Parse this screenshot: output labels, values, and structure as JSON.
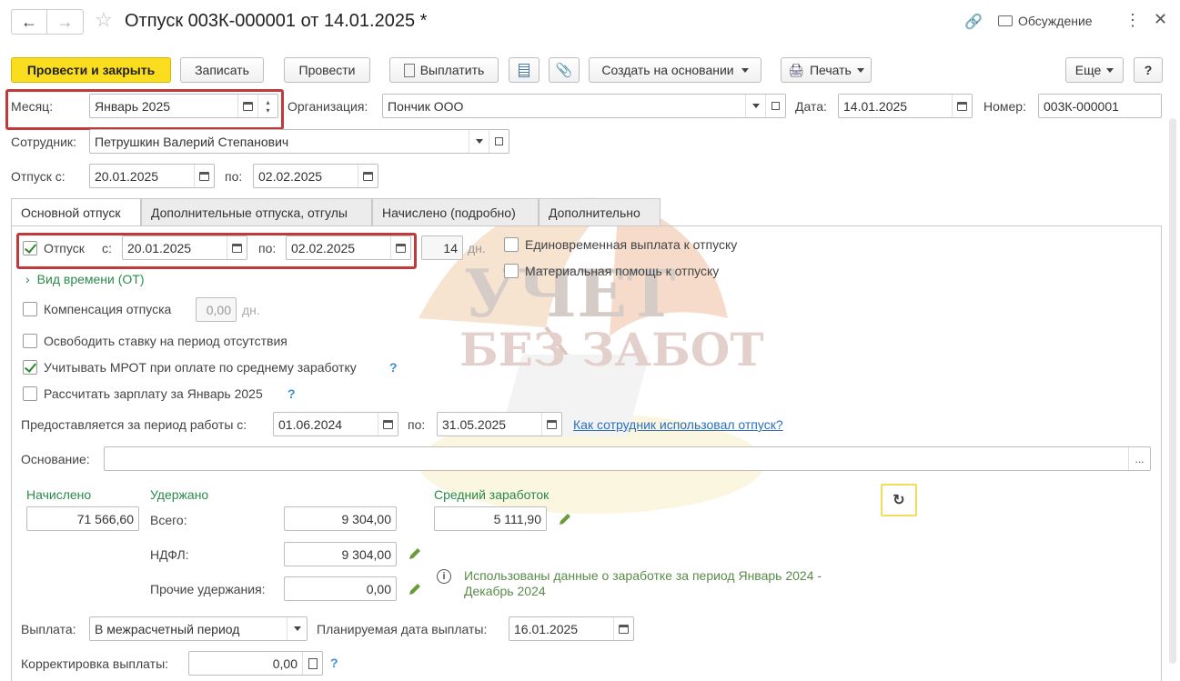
{
  "window": {
    "title": "Отпуск 003К-000001 от 14.01.2025 *",
    "discussion": "Обсуждение"
  },
  "toolbar": {
    "post_close": "Провести и закрыть",
    "save": "Записать",
    "post": "Провести",
    "pay": "Выплатить",
    "create_based": "Создать на основании",
    "print": "Печать",
    "more": "Еще",
    "help": "?"
  },
  "header": {
    "month_label": "Месяц:",
    "month_value": "Январь 2025",
    "org_label": "Организация:",
    "org_value": "Пончик ООО",
    "date_label": "Дата:",
    "date_value": "14.01.2025",
    "number_label": "Номер:",
    "number_value": "003К-000001",
    "employee_label": "Сотрудник:",
    "employee_value": "Петрушкин Валерий Степанович",
    "vac_from_label": "Отпуск с:",
    "vac_from_value": "20.01.2025",
    "vac_to_label": "по:",
    "vac_to_value": "02.02.2025"
  },
  "tabs": [
    "Основной отпуск",
    "Дополнительные отпуска, отгулы",
    "Начислено (подробно)",
    "Дополнительно"
  ],
  "main": {
    "vacation_label": "Отпуск",
    "from_label": "с:",
    "from_value": "20.01.2025",
    "to_label": "по:",
    "to_value": "02.02.2025",
    "days_value": "14",
    "days_unit": "дн.",
    "one_time_payment": "Единовременная выплата к отпуску",
    "material_help": "Материальная помощь к отпуску",
    "time_type": "Вид времени (ОТ)",
    "compensation": "Компенсация отпуска",
    "compensation_value": "0,00",
    "compensation_unit": "дн.",
    "release_rate": "Освободить ставку на период отсутствия",
    "mrot": "Учитывать МРОТ при оплате по среднему заработку",
    "calc_salary": "Рассчитать зарплату за Январь 2025",
    "period_label": "Предоставляется за период работы с:",
    "period_from": "01.06.2024",
    "period_to_label": "по:",
    "period_to": "31.05.2025",
    "how_used_link": "Как сотрудник использовал отпуск?",
    "basis_label": "Основание:",
    "basis_value": "",
    "accrued_label": "Начислено",
    "accrued_value": "71 566,60",
    "withheld_label": "Удержано",
    "total_label": "Всего:",
    "total_value": "9 304,00",
    "ndfl_label": "НДФЛ:",
    "ndfl_value": "9 304,00",
    "other_label": "Прочие удержания:",
    "other_value": "0,00",
    "avg_label": "Средний заработок",
    "avg_value": "5 111,90",
    "info_text_1": "Использованы данные о заработке за период Январь 2024 -",
    "info_text_2": "Декабрь 2024",
    "payout_label": "Выплата:",
    "payout_value": "В межрасчетный период",
    "planned_date_label": "Планируемая дата выплаты:",
    "planned_date_value": "16.01.2025",
    "correction_label": "Корректировка выплаты:",
    "correction_value": "0,00"
  },
  "watermark": {
    "line1": "УЧЕТ",
    "line2": "БЕЗ ЗАБОТ"
  },
  "colors": {
    "primary_button": "#fbdd1f",
    "highlight_border": "#c0393b",
    "accent_green": "#2a8a4a",
    "link_blue": "#2a6fc0"
  }
}
